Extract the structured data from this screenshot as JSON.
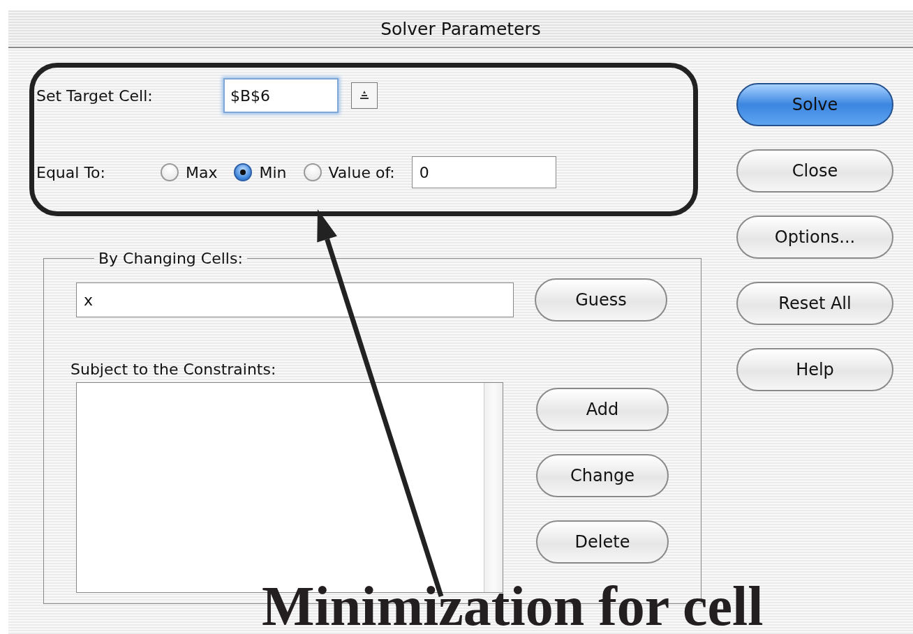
{
  "window": {
    "title": "Solver Parameters"
  },
  "target": {
    "label": "Set Target Cell:",
    "value": "$B$6"
  },
  "equal_to": {
    "label": "Equal To:",
    "options": [
      {
        "label": "Max",
        "selected": false
      },
      {
        "label": "Min",
        "selected": true
      },
      {
        "label": "Value of:",
        "selected": false
      }
    ],
    "value": "0"
  },
  "changing_cells": {
    "legend": "By Changing Cells:",
    "value": "x",
    "button": "Guess"
  },
  "constraints": {
    "label": "Subject to the Constraints:",
    "buttons": [
      "Add",
      "Change",
      "Delete"
    ]
  },
  "side_buttons": [
    {
      "label": "Solve",
      "default": true
    },
    {
      "label": "Close",
      "default": false
    },
    {
      "label": "Options...",
      "default": false
    },
    {
      "label": "Reset All",
      "default": false
    },
    {
      "label": "Help",
      "default": false
    }
  ],
  "annotation": {
    "caption": "Minimization for cell"
  }
}
